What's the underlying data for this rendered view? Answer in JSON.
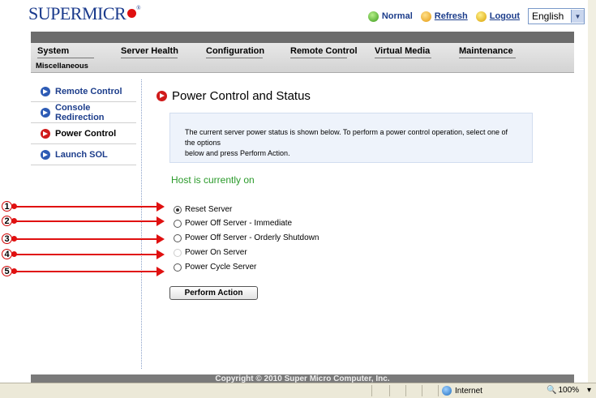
{
  "header": {
    "logo_text": "SUPERMICR",
    "logo_tm": "®",
    "status_label": "Normal",
    "refresh_label": "Refresh",
    "logout_label": "Logout",
    "language": "English"
  },
  "menu": {
    "items": [
      "System",
      "Server Health",
      "Configuration",
      "Remote Control",
      "Virtual Media",
      "Maintenance"
    ],
    "second_row": "Miscellaneous"
  },
  "sidebar": {
    "items": [
      {
        "label": "Remote Control"
      },
      {
        "label": "Console Redirection"
      },
      {
        "label": "Power Control"
      },
      {
        "label": "Launch SOL"
      }
    ]
  },
  "main": {
    "title": "Power Control and Status",
    "info_line1": "The current server power status is shown below. To perform a power control operation, select one of the options",
    "info_line2": "below and press Perform Action.",
    "host_status": "Host is currently on",
    "options": [
      {
        "label": "Reset Server",
        "checked": true,
        "disabled": false
      },
      {
        "label": "Power Off Server - Immediate",
        "checked": false,
        "disabled": false
      },
      {
        "label": "Power Off Server - Orderly Shutdown",
        "checked": false,
        "disabled": false
      },
      {
        "label": "Power On Server",
        "checked": false,
        "disabled": true
      },
      {
        "label": "Power Cycle Server",
        "checked": false,
        "disabled": false
      }
    ],
    "perform_button": "Perform Action"
  },
  "annotations": [
    "1",
    "2",
    "3",
    "4",
    "5"
  ],
  "footer": {
    "copyright": "Copyright © 2010 Super Micro Computer, Inc."
  },
  "browser_status": {
    "zone": "Internet",
    "zoom": "100%"
  },
  "colors": {
    "accent_red": "#e01010",
    "link_blue": "#1c3d8b",
    "status_green": "#2a9a2a"
  }
}
